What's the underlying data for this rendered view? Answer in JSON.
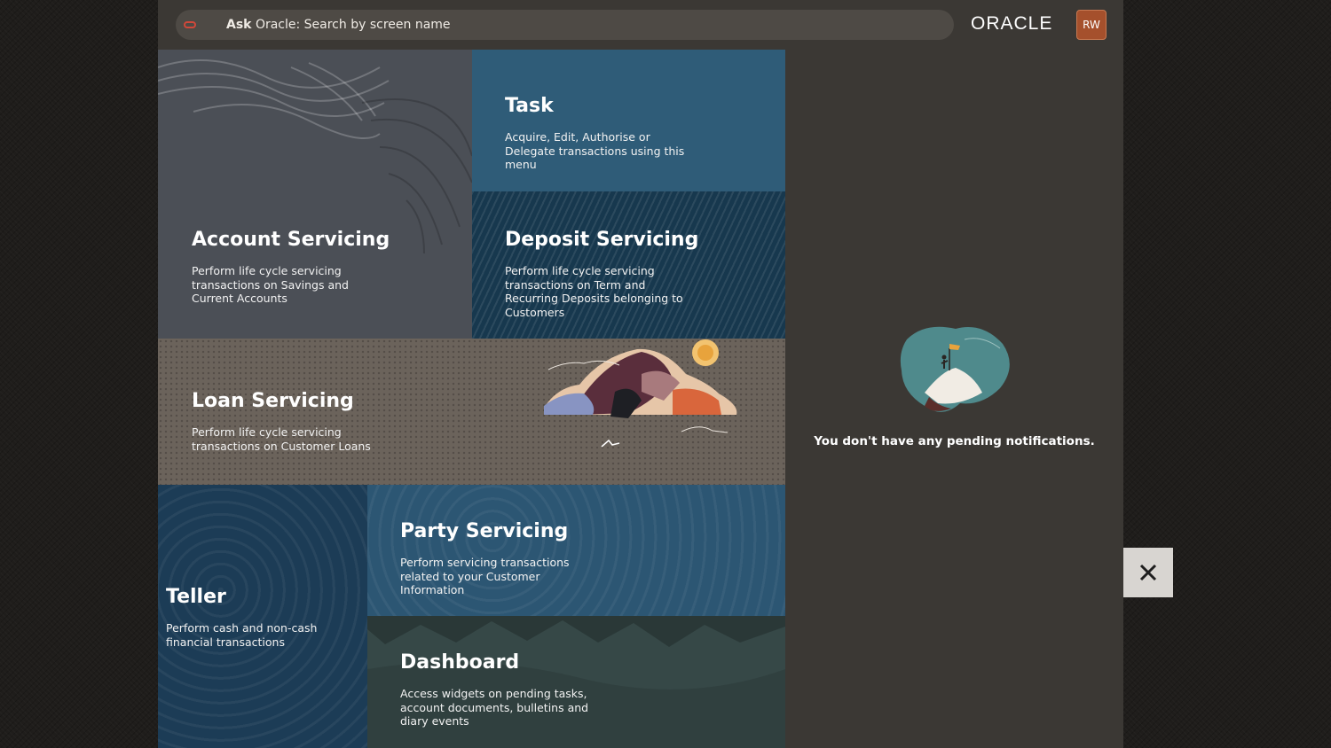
{
  "search": {
    "prefix": "Ask",
    "placeholder": "Oracle: Search by screen name"
  },
  "header": {
    "logo": "ORACLE",
    "avatar_initials": "RW"
  },
  "tiles": {
    "account": {
      "title": "Account Servicing",
      "desc": "Perform life cycle servicing transactions on Savings and Current Accounts"
    },
    "task": {
      "title": "Task",
      "desc": "Acquire, Edit, Authorise or Delegate transactions using this menu"
    },
    "deposit": {
      "title": "Deposit Servicing",
      "desc": "Perform life cycle servicing transactions on Term and Recurring Deposits belonging to Customers"
    },
    "loan": {
      "title": "Loan Servicing",
      "desc": "Perform life cycle servicing transactions on Customer Loans"
    },
    "teller": {
      "title": "Teller",
      "desc": "Perform cash and non-cash financial transactions"
    },
    "party": {
      "title": "Party Servicing",
      "desc": "Perform servicing transactions related to your Customer Information"
    },
    "dashboard": {
      "title": "Dashboard",
      "desc": "Access widgets on pending tasks, account documents, bulletins and diary events"
    }
  },
  "notifications": {
    "empty_message": "You don't have any pending notifications."
  },
  "colors": {
    "brand_red": "#d0483a",
    "avatar_bg": "#a5502c"
  }
}
